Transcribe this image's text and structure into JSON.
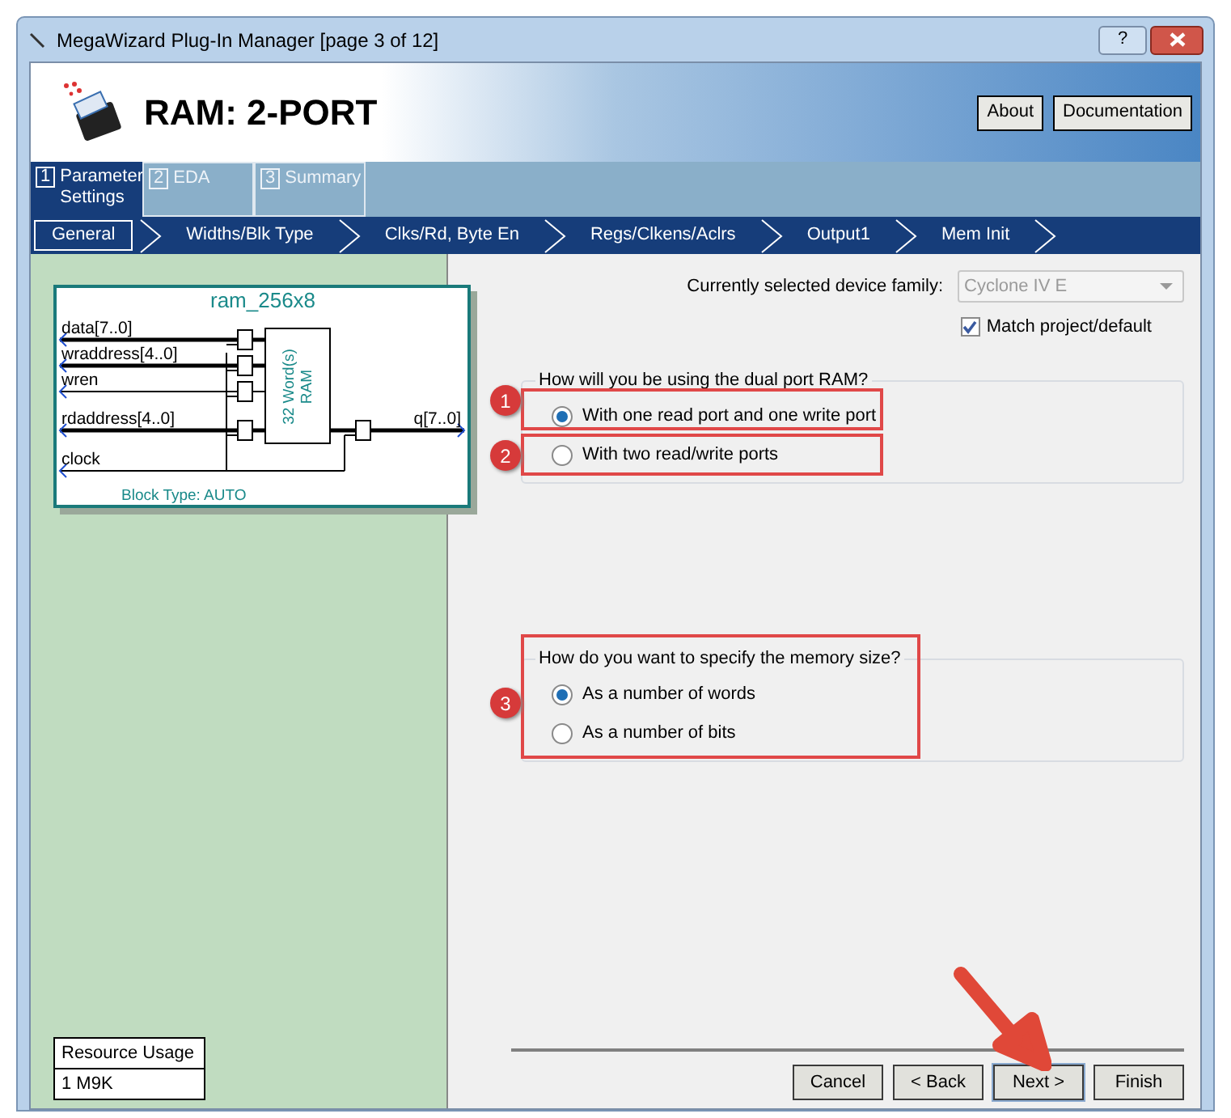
{
  "window": {
    "title": "MegaWizard Plug-In Manager [page 3 of 12]",
    "help": "?"
  },
  "header": {
    "title": "RAM: 2-PORT",
    "buttons": [
      "About",
      "Documentation"
    ]
  },
  "tabs": [
    {
      "number": "1",
      "label": "Parameter Settings",
      "selected": true
    },
    {
      "number": "2",
      "label": "EDA",
      "selected": false
    },
    {
      "number": "3",
      "label": "Summary",
      "selected": false
    }
  ],
  "steps": [
    {
      "label": "General",
      "selected": true
    },
    {
      "label": "Widths/Blk Type",
      "selected": false
    },
    {
      "label": "Clks/Rd, Byte En",
      "selected": false
    },
    {
      "label": "Regs/Clkens/Aclrs",
      "selected": false
    },
    {
      "label": "Output1",
      "selected": false
    },
    {
      "label": "Mem Init",
      "selected": false
    }
  ],
  "diagram": {
    "title": "ram_256x8",
    "inputs": [
      "data[7..0]",
      "wraddress[4..0]",
      "wren",
      "rdaddress[4..0]",
      "clock"
    ],
    "output": "q[7..0]",
    "core_label": [
      "32 Word(s)",
      "RAM"
    ],
    "block_type": "Block Type: AUTO"
  },
  "resource_usage": {
    "heading": "Resource Usage",
    "value": "1 M9K"
  },
  "device_family": {
    "label": "Currently selected device family:",
    "value": "Cyclone IV E",
    "disabled": true
  },
  "match_project": {
    "label": "Match project/default",
    "checked": true
  },
  "groups": [
    {
      "legend": "How will you be using the dual port RAM?",
      "options": [
        {
          "label": "With one read port and one write port",
          "selected": true
        },
        {
          "label": "With two read/write ports",
          "selected": false
        }
      ]
    },
    {
      "legend": "How do you want to specify the memory size?",
      "options": [
        {
          "label": "As a number of words",
          "selected": true
        },
        {
          "label": "As a number of bits",
          "selected": false
        }
      ]
    }
  ],
  "annotations": [
    "1",
    "2",
    "3"
  ],
  "buttons": [
    {
      "label": "Cancel",
      "focused": false
    },
    {
      "label": "< Back",
      "focused": false
    },
    {
      "label": "Next >",
      "focused": true
    },
    {
      "label": "Finish",
      "focused": false
    }
  ]
}
